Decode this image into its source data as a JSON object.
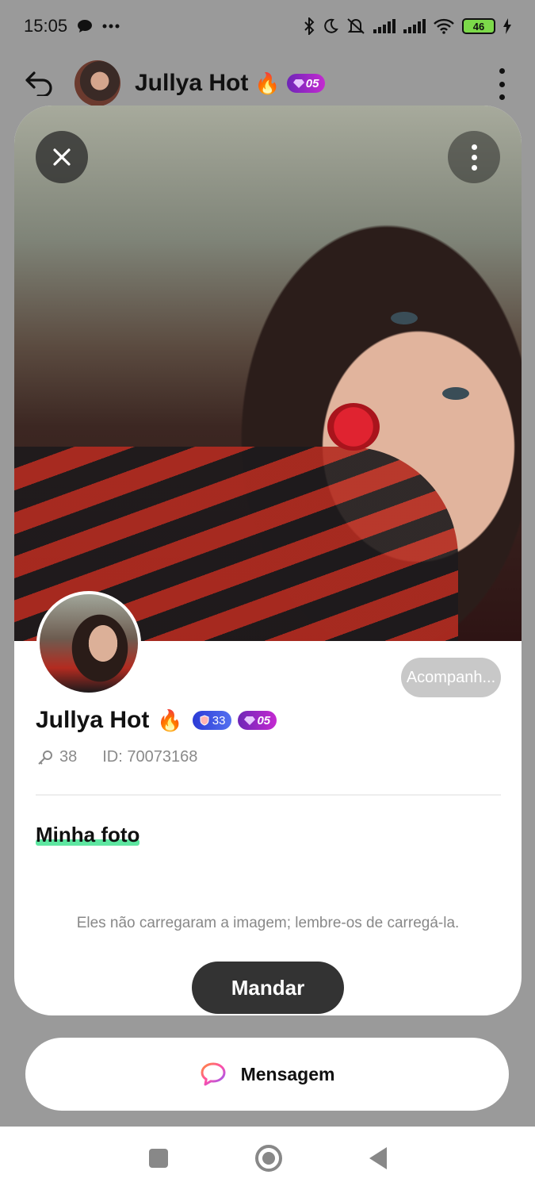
{
  "status_bar": {
    "time": "15:05",
    "battery": "46",
    "icons": [
      "chat-bubble-icon",
      "more-dots-icon",
      "bluetooth-icon",
      "moon-icon",
      "mute-icon",
      "signal-icon",
      "signal-icon",
      "wifi-icon",
      "battery-icon",
      "charging-icon"
    ]
  },
  "header": {
    "name": "Jullya Hot",
    "fire_emoji": "🔥",
    "level_badge": "05"
  },
  "profile": {
    "follow_label": "Acompanh...",
    "name": "Jullya Hot",
    "fire_emoji": "🔥",
    "wealth_badge": "33",
    "level_badge": "05",
    "followers": "38",
    "id_label": "ID: 70073168"
  },
  "photos": {
    "section_title": "Minha foto",
    "empty_hint": "Eles não carregaram a imagem; lembre-os de carregá-la.",
    "send_label": "Mandar"
  },
  "actions": {
    "message_label": "Mensagem"
  },
  "colors": {
    "accent_green": "#5ee6a1",
    "level_badge": "#8a2bd0",
    "wealth_badge": "#3a4fe0",
    "send_button": "#333333"
  }
}
